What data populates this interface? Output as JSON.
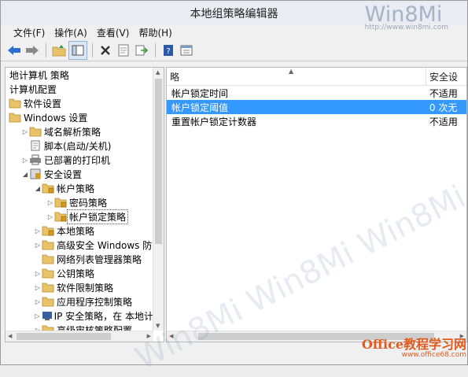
{
  "window": {
    "title": "本地组策略编辑器"
  },
  "watermark": {
    "logo": "Win8Mi",
    "url": "http://www.win8mi.com",
    "diagonal": "Win8Mi Win8Mi Win8Mi",
    "corner_brand": "Office教程学习网",
    "corner_url": "www.office68.com"
  },
  "menu": {
    "file": "文件(F)",
    "action": "操作(A)",
    "view": "查看(V)",
    "help": "帮助(H)"
  },
  "toolbar": {
    "icons": [
      "back-arrow-icon",
      "forward-arrow-icon",
      "up-folder-icon",
      "show-tree-icon",
      "delete-icon",
      "properties-icon",
      "export-icon",
      "help-icon",
      "console-view-icon"
    ]
  },
  "tree": {
    "rows": [
      {
        "label": "地计算机 策略",
        "indent": 0
      },
      {
        "label": "计算机配置",
        "indent": 0
      },
      {
        "label": "软件设置",
        "indent": 0
      },
      {
        "label": "Windows 设置",
        "indent": 0
      },
      {
        "label": "域名解析策略",
        "indent": 1
      },
      {
        "label": "脚本(启动/关机)",
        "indent": 1
      },
      {
        "label": "已部署的打印机",
        "indent": 1
      },
      {
        "label": "安全设置",
        "indent": 1
      },
      {
        "label": "帐户策略",
        "indent": 2
      },
      {
        "label": "密码策略",
        "indent": 3
      },
      {
        "label": "帐户锁定策略",
        "indent": 3
      },
      {
        "label": "本地策略",
        "indent": 2
      },
      {
        "label": "高级安全 Windows 防",
        "indent": 2
      },
      {
        "label": "网络列表管理器策略",
        "indent": 2
      },
      {
        "label": "公钥策略",
        "indent": 2
      },
      {
        "label": "软件限制策略",
        "indent": 2
      },
      {
        "label": "应用程序控制策略",
        "indent": 2
      },
      {
        "label": "IP 安全策略，在 本地计",
        "indent": 2
      },
      {
        "label": "高级审核策略配置",
        "indent": 2
      }
    ]
  },
  "list": {
    "col_policy": "略",
    "col_setting": "安全设",
    "rows": [
      {
        "policy": "帐户锁定时间",
        "setting": "不适用"
      },
      {
        "policy": "帐户锁定阈值",
        "setting": "0 次无"
      },
      {
        "policy": "重置帐户锁定计数器",
        "setting": "不适用"
      }
    ]
  },
  "colors": {
    "selection": "#3399ff",
    "folder": "#e8c36a"
  }
}
